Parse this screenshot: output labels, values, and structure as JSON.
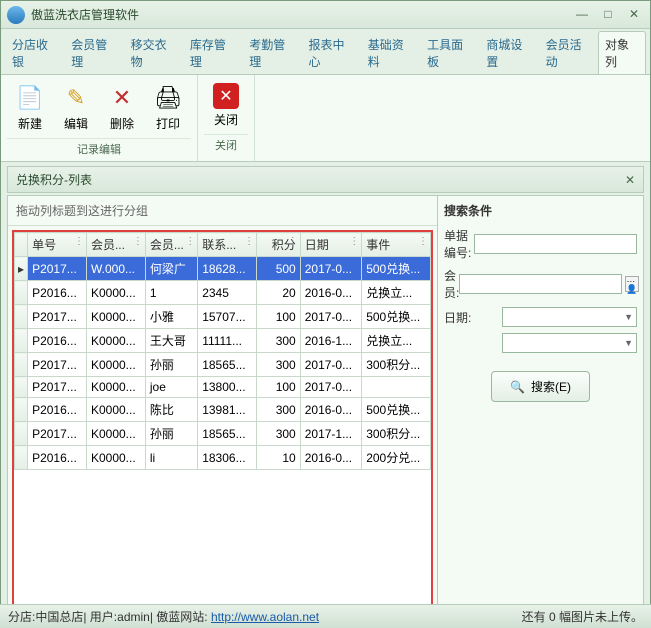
{
  "window": {
    "title": "傲蓝洗衣店管理软件"
  },
  "tabs": [
    "分店收银",
    "会员管理",
    "移交衣物",
    "库存管理",
    "考勤管理",
    "报表中心",
    "基础资料",
    "工具面板",
    "商城设置",
    "会员活动",
    "对象列"
  ],
  "ribbon": {
    "edit_group": "记录编辑",
    "close_group": "关闭",
    "new": "新建",
    "edit": "编辑",
    "delete": "删除",
    "print": "打印",
    "close": "关闭"
  },
  "sub": {
    "title": "兑换积分-列表"
  },
  "grid": {
    "hint": "拖动列标题到这进行分组",
    "headers": {
      "no": "单号",
      "vip": "会员...",
      "name": "会员...",
      "tel": "联系...",
      "pts": "积分",
      "date": "日期",
      "evt": "事件"
    },
    "rows": [
      {
        "no": "P2017...",
        "vip": "W.000...",
        "name": "何梁广",
        "tel": "18628...",
        "pts": "500",
        "date": "2017-0...",
        "evt": "500兑换..."
      },
      {
        "no": "P2016...",
        "vip": "K0000...",
        "name": "1",
        "tel": "2345",
        "pts": "20",
        "date": "2016-0...",
        "evt": "兑换立..."
      },
      {
        "no": "P2017...",
        "vip": "K0000...",
        "name": "小雅",
        "tel": "15707...",
        "pts": "100",
        "date": "2017-0...",
        "evt": "500兑换..."
      },
      {
        "no": "P2016...",
        "vip": "K0000...",
        "name": "王大哥",
        "tel": "11111...",
        "pts": "300",
        "date": "2016-1...",
        "evt": "兑换立..."
      },
      {
        "no": "P2017...",
        "vip": "K0000...",
        "name": "孙丽",
        "tel": "18565...",
        "pts": "300",
        "date": "2017-0...",
        "evt": "300积分..."
      },
      {
        "no": "P2017...",
        "vip": "K0000...",
        "name": "joe",
        "tel": "13800...",
        "pts": "100",
        "date": "2017-0...",
        "evt": ""
      },
      {
        "no": "P2016...",
        "vip": "K0000...",
        "name": "陈比",
        "tel": "13981...",
        "pts": "300",
        "date": "2016-0...",
        "evt": "500兑换..."
      },
      {
        "no": "P2017...",
        "vip": "K0000...",
        "name": "孙丽",
        "tel": "18565...",
        "pts": "300",
        "date": "2017-1...",
        "evt": "300积分..."
      },
      {
        "no": "P2016...",
        "vip": "K0000...",
        "name": "li",
        "tel": "18306...",
        "pts": "10",
        "date": "2016-0...",
        "evt": "200分兑..."
      }
    ]
  },
  "search": {
    "title": "搜索条件",
    "label_no": "单据编号:",
    "label_vip": "会员:",
    "label_date": "日期:",
    "button": "搜索(E)"
  },
  "status": {
    "left_prefix": "分店: ",
    "branch": "中国总店",
    "user_prefix": " | 用户: ",
    "user": "admin",
    "site_prefix": " | 傲蓝网站: ",
    "url": "http://www.aolan.net",
    "right": "还有 0 幅图片未上传。"
  }
}
